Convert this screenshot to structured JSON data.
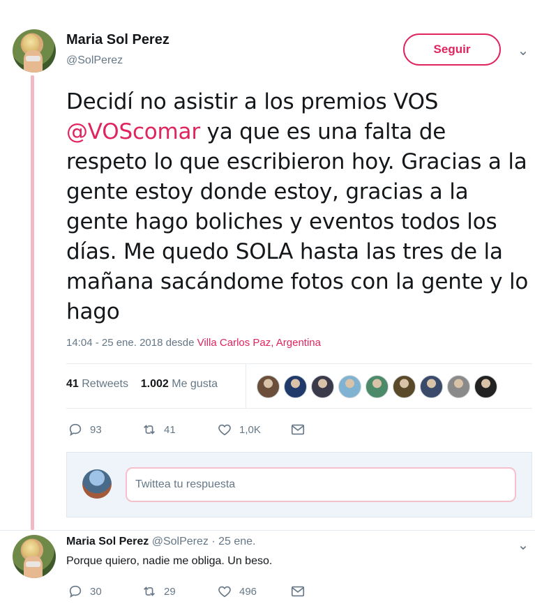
{
  "tweet": {
    "author_name": "Maria Sol Perez",
    "author_handle": "@SolPerez",
    "follow_label": "Seguir",
    "text_before_mention": "Decidí no asistir a los premios VOS ",
    "mention": "@VOScomar",
    "text_after_mention": " ya que es una falta de respeto lo que escribieron hoy. Gracias a la gente estoy donde estoy, gracias a la gente hago boliches y eventos todos los días. Me quedo SOLA hasta las tres de la mañana sacándome fotos con la gente y lo hago",
    "timestamp": "14:04 - 25 ene. 2018 desde ",
    "location": "Villa Carlos Paz, Argentina",
    "retweets_count": "41",
    "retweets_label": "Retweets",
    "likes_count": "1.002",
    "likes_label": "Me gusta",
    "liker_colors": [
      "#6b4f3a",
      "#1f3a6b",
      "#3a3a4a",
      "#7fb3d1",
      "#4c8a6a",
      "#5a4a2a",
      "#3a4a6a",
      "#8a8a8a",
      "#222222"
    ],
    "actions": {
      "replies": "93",
      "retweets": "41",
      "likes": "1,0K"
    },
    "accent_color": "#e0245e"
  },
  "reply_composer": {
    "placeholder": "Twittea tu respuesta"
  },
  "reply": {
    "author_name": "Maria Sol Perez",
    "author_handle_time": "@SolPerez · 25 ene.",
    "text": "Porque quiero, nadie me obliga. Un beso.",
    "actions": {
      "replies": "30",
      "retweets": "29",
      "likes": "496"
    }
  }
}
